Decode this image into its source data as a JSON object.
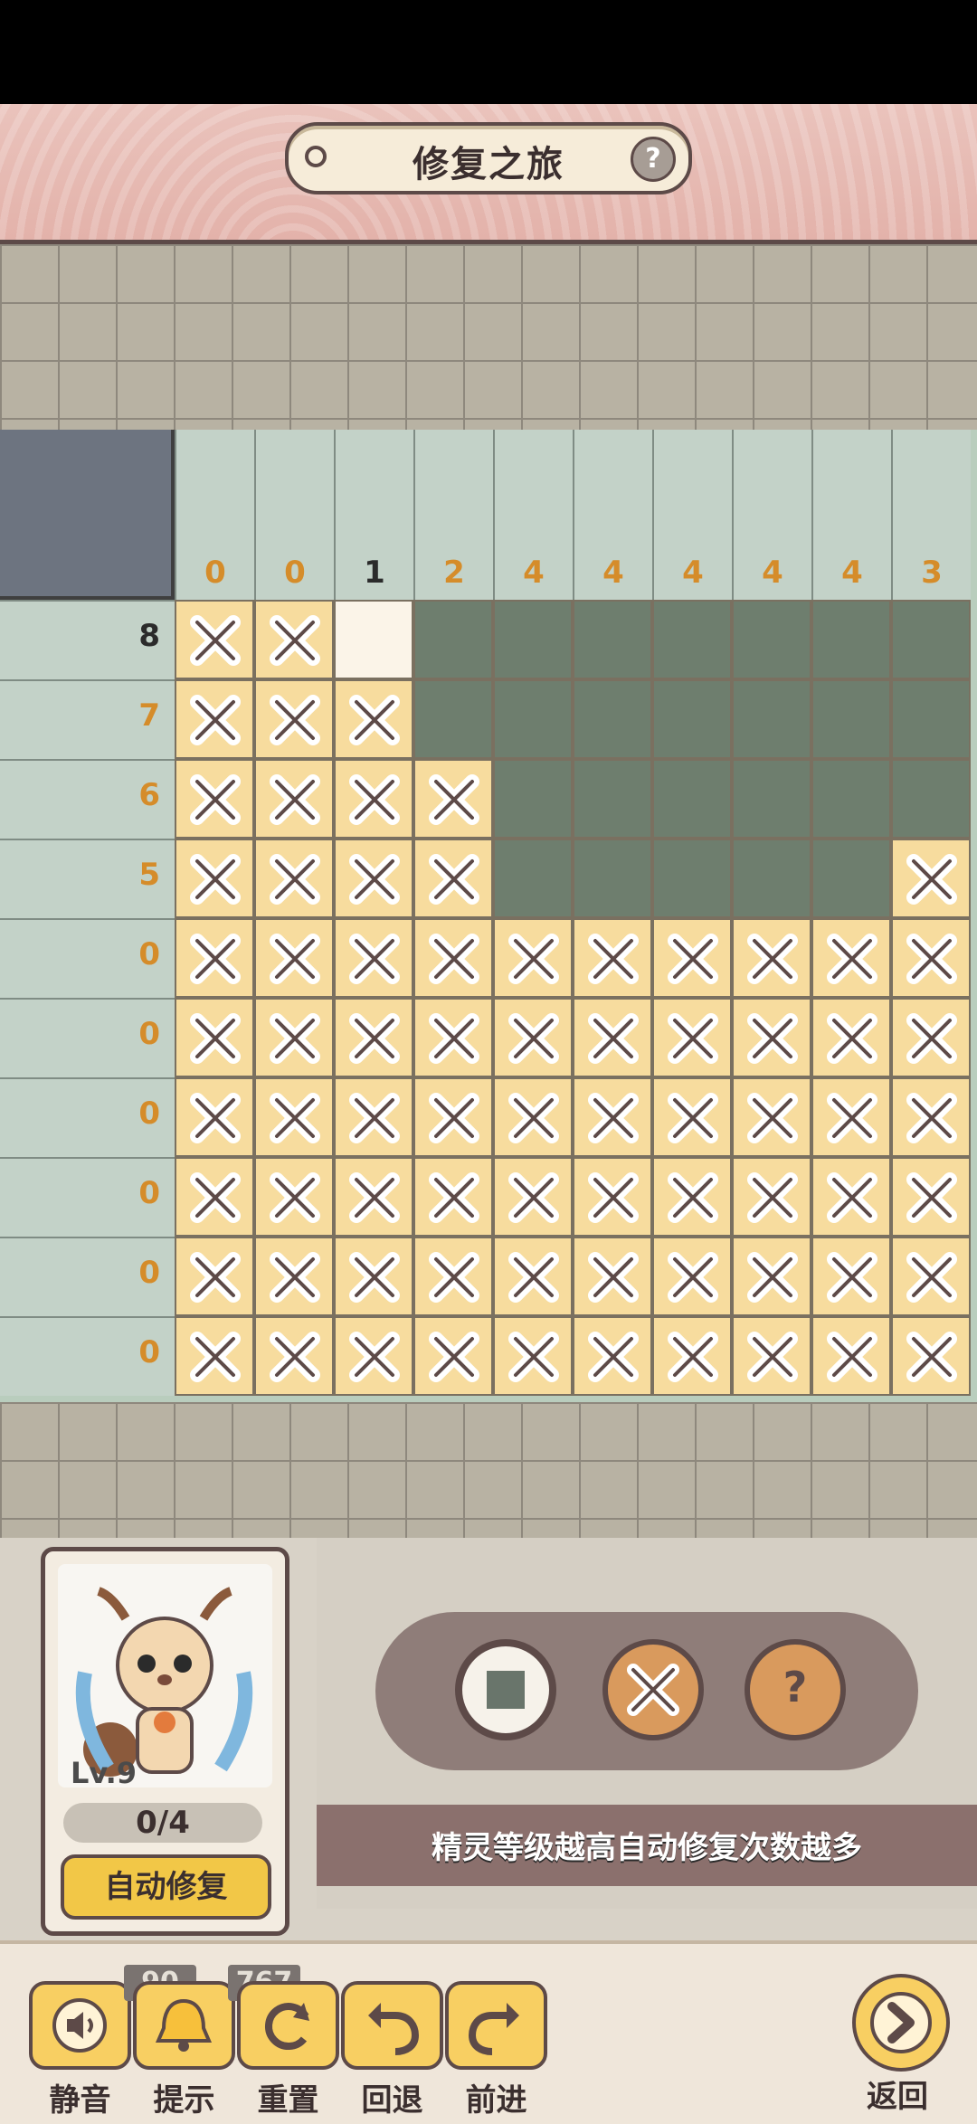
{
  "header": {
    "title": "修复之旅",
    "help_label": "?"
  },
  "clues": {
    "columns": [
      "0",
      "0",
      "1",
      "2",
      "4",
      "4",
      "4",
      "4",
      "4",
      "3"
    ],
    "rows": [
      "8",
      "7",
      "6",
      "5",
      "0",
      "0",
      "0",
      "0",
      "0",
      "0"
    ]
  },
  "board": {
    "filled_rows": [
      [
        "x",
        "x",
        "e",
        "f",
        "f",
        "f",
        "f",
        "f",
        "f",
        "f"
      ],
      [
        "x",
        "x",
        "x",
        "f",
        "f",
        "f",
        "f",
        "f",
        "f",
        "f"
      ],
      [
        "x",
        "x",
        "x",
        "x",
        "f",
        "f",
        "f",
        "f",
        "f",
        "f"
      ],
      [
        "x",
        "x",
        "x",
        "x",
        "f",
        "f",
        "f",
        "f",
        "f",
        "x"
      ],
      [
        "x",
        "x",
        "x",
        "x",
        "x",
        "x",
        "x",
        "x",
        "x",
        "x"
      ],
      [
        "x",
        "x",
        "x",
        "x",
        "x",
        "x",
        "x",
        "x",
        "x",
        "x"
      ],
      [
        "x",
        "x",
        "x",
        "x",
        "x",
        "x",
        "x",
        "x",
        "x",
        "x"
      ],
      [
        "x",
        "x",
        "x",
        "x",
        "x",
        "x",
        "x",
        "x",
        "x",
        "x"
      ],
      [
        "x",
        "x",
        "x",
        "x",
        "x",
        "x",
        "x",
        "x",
        "x",
        "x"
      ],
      [
        "x",
        "x",
        "x",
        "x",
        "x",
        "x",
        "x",
        "x",
        "x",
        "x"
      ]
    ]
  },
  "spirit": {
    "level_label": "Lv.9",
    "progress_label": "0/4",
    "auto_button_label": "自动修复"
  },
  "tools": {
    "fill_tool": "square-tool",
    "cross_tool": "cross-tool",
    "mark_tool": "question-tool",
    "mark_label": "?"
  },
  "tip": {
    "text": "精灵等级越高自动修复次数越多"
  },
  "bottom": {
    "mute_label": "静音",
    "hint_label": "提示",
    "hint_count": "90",
    "reset_label": "重置",
    "reset_count": "767",
    "undo_label": "回退",
    "redo_label": "前进",
    "back_label": "返回"
  },
  "colors": {
    "filled": "#6e7e6e",
    "cross": "#f7dc9e",
    "empty": "#fbf4e8",
    "clue_orange": "#d58c2a"
  }
}
